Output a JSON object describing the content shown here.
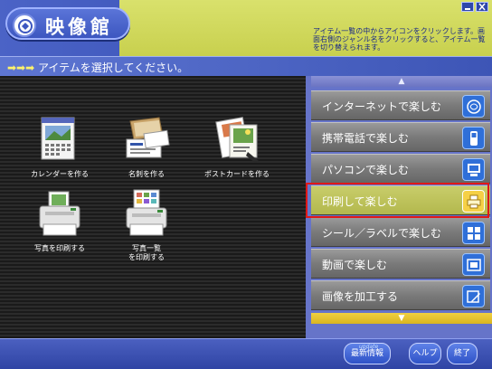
{
  "header": {
    "title": "映像館",
    "description": "アイテム一覧の中からアイコンをクリックします。画面右側のジャンル名をクリックすると、アイテム一覧を切り替えられます。",
    "colors": {
      "blue": "#3a53b8",
      "yellow": "#c8d04e"
    }
  },
  "instruction": {
    "arrows": "➡➡➡",
    "text": "アイテムを選択してください。"
  },
  "items": [
    {
      "label": "カレンダーを作る",
      "icon": "calendar-icon"
    },
    {
      "label": "名刺を作る",
      "icon": "business-card-icon"
    },
    {
      "label": "ポストカードを作る",
      "icon": "postcard-icon"
    },
    {
      "label": "写真を印刷する",
      "icon": "photo-printer-icon"
    },
    {
      "label": "写真一覧\nを印刷する",
      "icon": "photo-list-printer-icon"
    }
  ],
  "categories": [
    {
      "label": "インターネットで楽しむ",
      "icon": "internet-icon",
      "selected": false
    },
    {
      "label": "携帯電話で楽しむ",
      "icon": "mobile-phone-icon",
      "selected": false
    },
    {
      "label": "パソコンで楽しむ",
      "icon": "computer-icon",
      "selected": false
    },
    {
      "label": "印刷して楽しむ",
      "icon": "printer-icon",
      "selected": true
    },
    {
      "label": "シール／ラベルで楽しむ",
      "icon": "sticker-icon",
      "selected": false
    },
    {
      "label": "動画で楽しむ",
      "icon": "video-icon",
      "selected": false
    },
    {
      "label": "画像を加工する",
      "icon": "image-edit-icon",
      "selected": false
    }
  ],
  "scroll": {
    "up": "▲",
    "down": "▼"
  },
  "footer": {
    "news_sup": "update",
    "news_label": "最新情報",
    "help_label": "ヘルプ",
    "exit_label": "終了"
  }
}
